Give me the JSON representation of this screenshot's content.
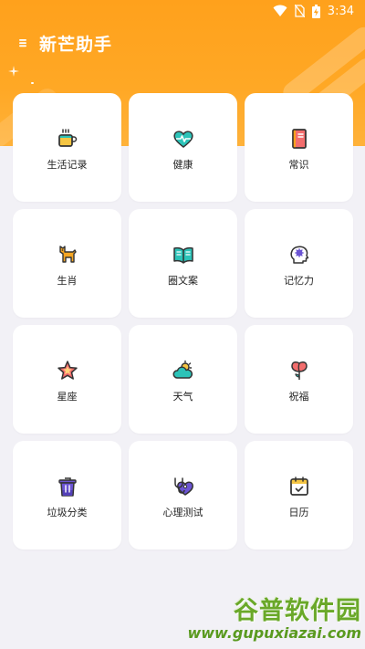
{
  "statusbar": {
    "time": "3:34"
  },
  "appbar": {
    "title": "新芒助手"
  },
  "grid": {
    "items": [
      {
        "label": "生活记录",
        "icon": "coffee-cup-icon"
      },
      {
        "label": "健康",
        "icon": "heart-pulse-icon"
      },
      {
        "label": "常识",
        "icon": "book-icon"
      },
      {
        "label": "生肖",
        "icon": "dog-icon"
      },
      {
        "label": "圈文案",
        "icon": "open-book-icon"
      },
      {
        "label": "记忆力",
        "icon": "brain-head-icon"
      },
      {
        "label": "星座",
        "icon": "star-icon"
      },
      {
        "label": "天气",
        "icon": "weather-icon"
      },
      {
        "label": "祝福",
        "icon": "tulip-icon"
      },
      {
        "label": "垃圾分类",
        "icon": "trash-bin-icon"
      },
      {
        "label": "心理测试",
        "icon": "stethoscope-heart-icon"
      },
      {
        "label": "日历",
        "icon": "calendar-icon"
      }
    ]
  },
  "watermark": {
    "title": "谷普软件园",
    "url": "www.gupuxiazai.com"
  },
  "colors": {
    "accent": "#ffa11c",
    "background": "#f2f1f6",
    "card": "#ffffff",
    "icon_teal": "#2bc3b8",
    "icon_orange": "#f5a623",
    "icon_purple": "#6b54d4",
    "icon_pink": "#f36d6d"
  }
}
